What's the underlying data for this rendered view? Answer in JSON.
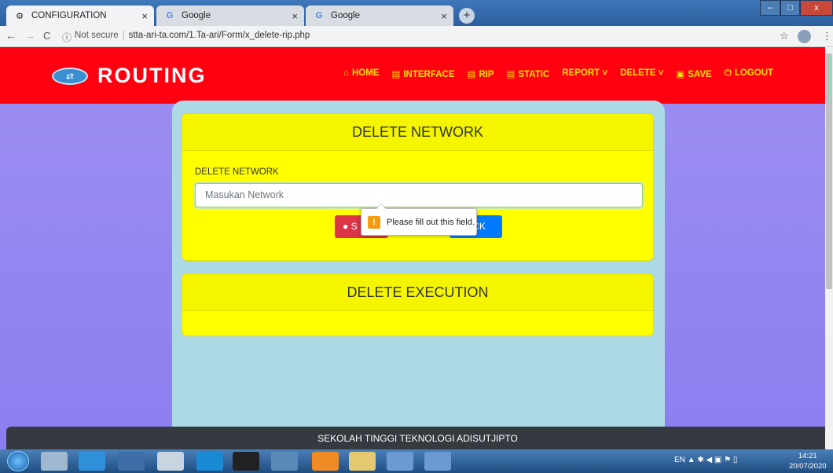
{
  "browser": {
    "tabs": [
      {
        "title": "CONFIGURATION",
        "active": true
      },
      {
        "title": "Google",
        "active": false
      },
      {
        "title": "Google",
        "active": false
      }
    ],
    "tab_close": "×",
    "new_tab": "+",
    "window_controls": {
      "minimize": "–",
      "maximize": "□",
      "close": "x"
    },
    "address": {
      "security": "Not secure",
      "url": "stta-ari-ta.com/1.Ta-ari/Form/x_delete-rip.php"
    },
    "nav": {
      "back": "←",
      "forward": "→",
      "reload": "C",
      "info": "ⓘ",
      "star": "☆",
      "menu": "⋮"
    }
  },
  "site": {
    "brand": "ROUTING",
    "menu": [
      {
        "icon": "home-icon",
        "glyph": "⌂",
        "label": "HOME"
      },
      {
        "icon": "list-icon",
        "glyph": "▤",
        "label": "INTERFACE"
      },
      {
        "icon": "list-icon",
        "glyph": "▤",
        "label": "RIP"
      },
      {
        "icon": "list-icon",
        "glyph": "▤",
        "label": "STATIC"
      },
      {
        "icon": "",
        "glyph": "",
        "label": "REPORT ˅"
      },
      {
        "icon": "",
        "glyph": "",
        "label": "DELETE ˅"
      },
      {
        "icon": "save-icon",
        "glyph": "▣",
        "label": "SAVE"
      },
      {
        "icon": "power-icon",
        "glyph": "⏻",
        "label": "LOGOUT"
      }
    ]
  },
  "main": {
    "card1": {
      "title": "DELETE NETWORK",
      "field_label": "DELETE NETWORK",
      "field_placeholder": "Masukan Network",
      "submit_label": "S",
      "back_label": "ACK"
    },
    "tooltip": "Please fill out this field.",
    "card2": {
      "title": "DELETE EXECUTION"
    }
  },
  "footer": "SEKOLAH TINGGI TEKNOLOGI ADISUTJIPTO",
  "taskbar": {
    "lang": "EN",
    "time": "14:21",
    "date": "20/07/2020"
  },
  "colors": {
    "navbar": "#ff0010",
    "menu_text": "#ffe600",
    "card": "#ffff00",
    "container": "#add8e6",
    "background": "#8b7ef0",
    "footer": "#343a40"
  }
}
